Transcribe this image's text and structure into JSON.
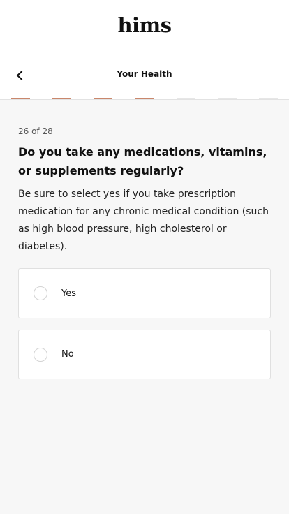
{
  "brand": {
    "logo_text": "hims"
  },
  "nav": {
    "title": "Your Health",
    "back_icon": "chevron-left-icon",
    "progress": {
      "completed_segments": 4,
      "total_segments": 7
    }
  },
  "question": {
    "step": "26 of 28",
    "title": "Do you take any medications, vitamins, or supplements regularly?",
    "helper": "Be sure to select yes if you take prescription medication for any chronic medical condition (such as high blood pressure, high cholesterol or diabetes).",
    "options": [
      {
        "label": "Yes",
        "selected": false
      },
      {
        "label": "No",
        "selected": false
      }
    ]
  },
  "colors": {
    "progress_done": "#c9876c",
    "progress_todo": "#e6e6e6",
    "background": "#f7f7f7"
  }
}
